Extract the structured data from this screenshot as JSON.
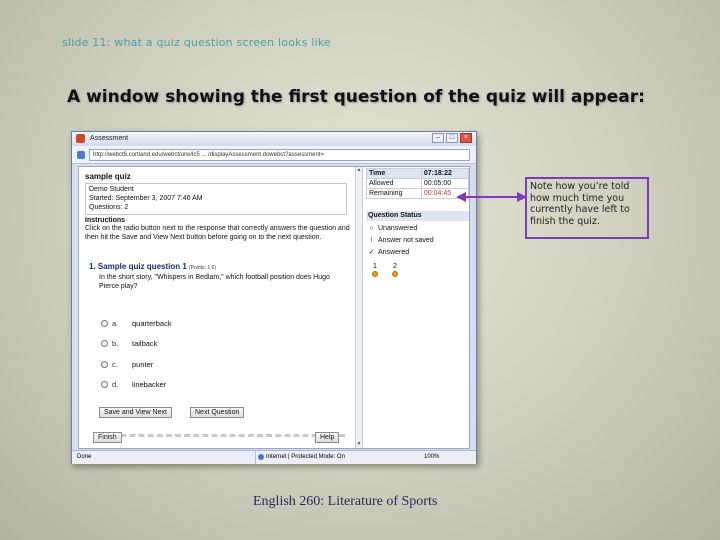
{
  "slide": {
    "label": "slide 11: what a quiz question screen looks like",
    "heading": "A window showing the first question of the quiz will appear:",
    "footer": "English 260: Literature of Sports",
    "callout": "Note how you’re told how much time you currently have left to finish the quiz."
  },
  "browser": {
    "title": "Assessment",
    "url": "http://webct6.cortland.edu/webct/urw/lc5 ... /displayAssessment.dowebct?assessment=",
    "status_done": "Done",
    "status_zone": "Internet | Protected Mode: On",
    "status_zoom": "100%"
  },
  "quiz": {
    "title": "sample quiz",
    "student": "Demo Student",
    "started": "Started: September 3, 2007 7:46 AM",
    "questions": "Questions: 2",
    "instructions_label": "Instructions",
    "instructions": "Click on the radio button next to the response that correctly answers the question and then hit the Save and View Next button before going on to the next question.",
    "question_title": "1.  Sample quiz question 1",
    "question_points": "(Points: 1.0)",
    "question_text": "In the short story, \"Whispers in Bedlam,\" which football position does Hugo Pierce play?",
    "options": [
      {
        "letter": "a.",
        "text": "quarterback"
      },
      {
        "letter": "b.",
        "text": "tailback"
      },
      {
        "letter": "c.",
        "text": "punter"
      },
      {
        "letter": "d.",
        "text": "linebacker"
      }
    ],
    "save_button": "Save and View Next",
    "next_button": "Next Question",
    "finish_button": "Finish",
    "help_button": "Help"
  },
  "sidebar": {
    "time_label": "Time",
    "time_value": "07:18:22",
    "allowed_label": "Allowed",
    "allowed_value": "00:05:00",
    "remaining_label": "Remaining",
    "remaining_value": "00:04:45",
    "status_head": "Question Status",
    "status_items": [
      {
        "mark": "○",
        "label": "Unanswered"
      },
      {
        "mark": "I",
        "label": "Answer not saved"
      },
      {
        "mark": "✓",
        "label": "Answered"
      }
    ],
    "question_numbers": [
      "1",
      "2"
    ]
  },
  "colors": {
    "heading": "#111111",
    "label": "#4aa0a8",
    "callout_border": "#7d3cb8",
    "remaining": "#c0392b"
  }
}
